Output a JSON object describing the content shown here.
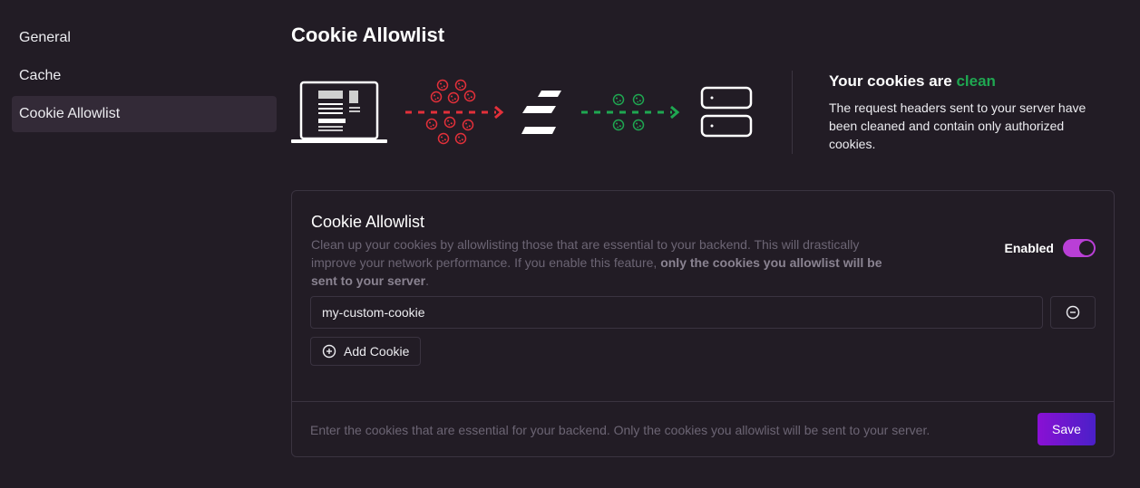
{
  "sidebar": {
    "items": [
      {
        "label": "General"
      },
      {
        "label": "Cache"
      },
      {
        "label": "Cookie Allowlist"
      }
    ]
  },
  "page": {
    "title": "Cookie Allowlist"
  },
  "hero": {
    "heading_prefix": "Your cookies are ",
    "heading_accent": "clean",
    "description": "The request headers sent to your server have been cleaned and contain only authorized cookies.",
    "icons": [
      "laptop-icon",
      "red-cookies-icon",
      "red-arrow-icon",
      "logo-icon",
      "green-cookies-icon",
      "green-arrow-icon",
      "server-icon"
    ],
    "colors": {
      "accent": "#1fa751",
      "dirty": "#e3303a",
      "clean": "#1fa751"
    }
  },
  "card": {
    "title": "Cookie Allowlist",
    "description_plain": "Clean up your cookies by allowlisting those that are essential to your backend. This will drastically improve your network performance. If you enable this feature, ",
    "description_bold": "only the cookies you allowlist will be sent to your server",
    "description_end": ".",
    "toggle": {
      "label": "Enabled",
      "on": true,
      "color": "#b93fd6"
    },
    "cookies": [
      {
        "value": "my-custom-cookie"
      }
    ],
    "remove_icon": "minus-circle-icon",
    "add_button": {
      "label": "Add Cookie",
      "icon": "plus-circle-icon"
    },
    "footer_text": "Enter the cookies that are essential for your backend. Only the cookies you allowlist will be sent to your server.",
    "save_label": "Save"
  }
}
